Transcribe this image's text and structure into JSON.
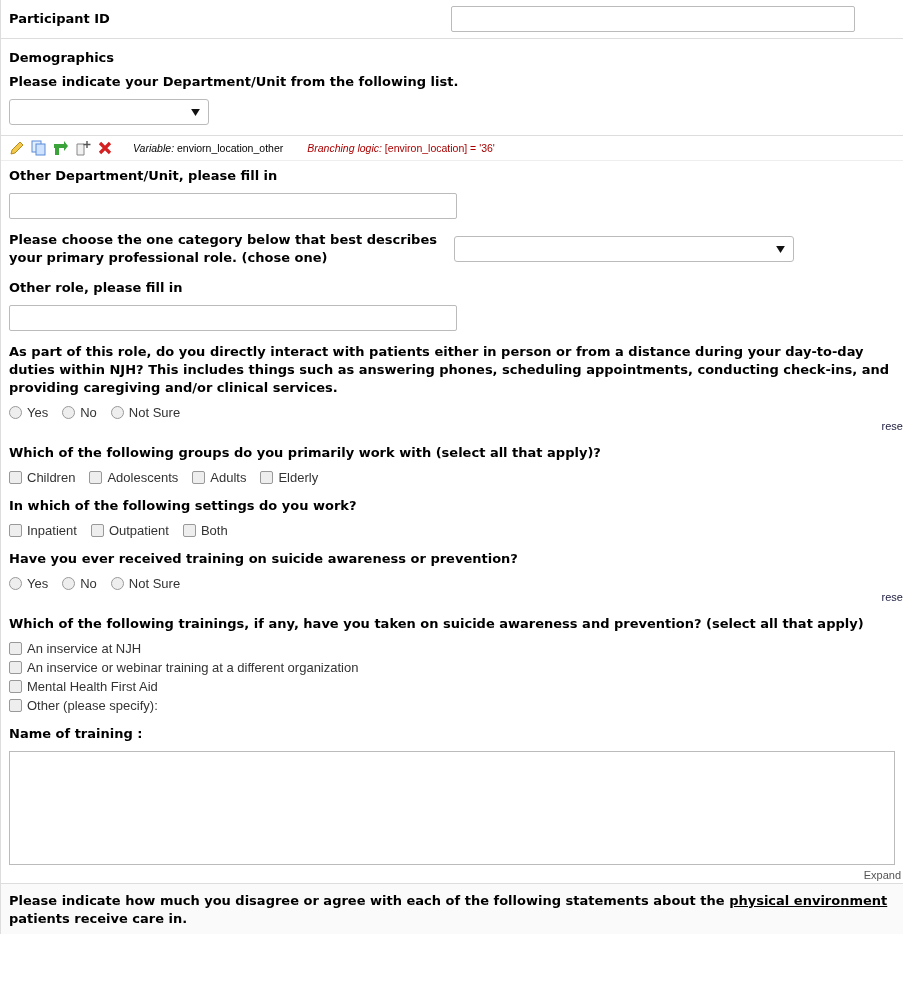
{
  "fields": [
    {
      "kind": "text-inline",
      "label": "Participant ID"
    },
    {
      "kind": "header",
      "label": "Demographics"
    },
    {
      "kind": "select",
      "label": "Please indicate your Department/Unit from the following list."
    },
    {
      "kind": "toolbar",
      "variable_label": "Variable:",
      "variable": "enviorn_location_other",
      "branching_label": "Branching logic:",
      "branching": "[environ_location] = '36'"
    },
    {
      "kind": "text",
      "label": "Other Department/Unit, please fill in"
    },
    {
      "kind": "select-inline",
      "label": "Please choose the one category below that best describes your primary professional role. (chose one)"
    },
    {
      "kind": "text",
      "label": "Other role, please fill in"
    },
    {
      "kind": "radio",
      "label": "As part of this role, do you directly interact with patients either in person or from a distance during your day-to-day duties within NJH? This includes things such as answering phones, scheduling appointments, conducting check-ins, and providing caregiving and/or clinical services.",
      "reset": "rese",
      "options": [
        {
          "label": "Yes",
          "selected": false
        },
        {
          "label": "No",
          "selected": false
        },
        {
          "label": "Not Sure",
          "selected": false
        }
      ]
    },
    {
      "kind": "checkbox",
      "label": "Which of the following groups do you primarily work with (select all that apply)?",
      "options": [
        {
          "label": "Children",
          "checked": false
        },
        {
          "label": "Adolescents",
          "checked": false
        },
        {
          "label": "Adults",
          "checked": false
        },
        {
          "label": "Elderly",
          "checked": false
        }
      ]
    },
    {
      "kind": "checkbox",
      "label": "In which of the following settings do you work?",
      "options": [
        {
          "label": "Inpatient",
          "checked": false
        },
        {
          "label": "Outpatient",
          "checked": false
        },
        {
          "label": "Both",
          "checked": false
        }
      ]
    },
    {
      "kind": "radio",
      "label": "Have you ever received training on suicide awareness or prevention?",
      "reset": "rese",
      "options": [
        {
          "label": "Yes",
          "selected": false
        },
        {
          "label": "No",
          "selected": false
        },
        {
          "label": "Not Sure",
          "selected": false
        }
      ]
    },
    {
      "kind": "checkbox-list",
      "label": "Which of the following trainings, if any, have you taken on suicide awareness and prevention? (select all that apply)",
      "options": [
        {
          "label": "An inservice at NJH",
          "checked": false
        },
        {
          "label": "An inservice or webinar training at a different organization",
          "checked": false
        },
        {
          "label": "Mental Health First Aid",
          "checked": false
        },
        {
          "label": "Other (please specify):",
          "checked": false
        }
      ]
    },
    {
      "kind": "textarea",
      "label": "Name of training :",
      "expand": "Expand"
    },
    {
      "kind": "descriptive",
      "text": "Please indicate how much you disagree or agree with each of the following statements about the",
      "underlined": "physical environment",
      "text_after": "patients receive care in."
    }
  ]
}
